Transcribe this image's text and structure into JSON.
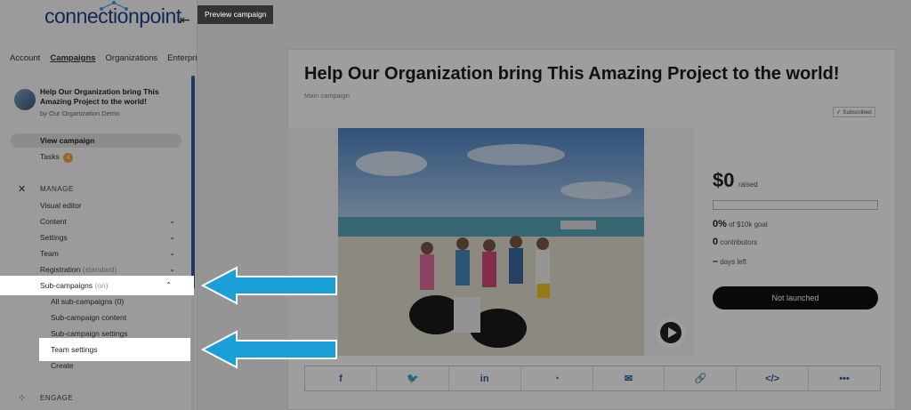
{
  "app": {
    "logo_text": "connectionpoint",
    "tooltip": "Preview campaign"
  },
  "sidebar": {
    "tabs": [
      "Account",
      "Campaigns",
      "Organizations",
      "Enterprise"
    ],
    "campaign": {
      "title": "Help Our Organization bring This Amazing Project to the world!",
      "by": "by Our Organization Demo"
    },
    "view_campaign": "View campaign",
    "tasks_label": "Tasks",
    "tasks_count": "4",
    "manage_heading": "MANAGE",
    "items": [
      {
        "label": "Visual editor",
        "chevron": ""
      },
      {
        "label": "Content",
        "chevron": "⌄"
      },
      {
        "label": "Settings",
        "chevron": "⌄"
      },
      {
        "label": "Team",
        "chevron": "⌄"
      },
      {
        "label": "Registration",
        "suffix": "(standard)",
        "chevron": "⌄"
      }
    ],
    "subcampaigns": {
      "label": "Sub-campaigns",
      "suffix": "(on)",
      "chevron": "⌃"
    },
    "sub_items": [
      "All sub-campaigns (0)",
      "Sub-campaign content",
      "Sub-campaign settings"
    ],
    "team_settings": "Team settings",
    "create": "Create",
    "engage_heading": "ENGAGE"
  },
  "campaign": {
    "title": "Help Our Organization bring This Amazing Project to the world!",
    "subtitle": "Main campaign",
    "subscribed": "Subscribed",
    "raised_amount": "$0",
    "raised_label": "raised",
    "progress_fraction": 0.0,
    "goal_pct": "0%",
    "goal_label": "of $10k goal",
    "contributors_count": "0",
    "contributors_label": "contributors",
    "days_value": "–",
    "days_label": "days left",
    "status_button": "Not launched"
  },
  "share": [
    "facebook-icon",
    "twitter-icon",
    "linkedin-icon",
    "messenger-icon",
    "email-icon",
    "link-icon",
    "embed-icon",
    "more-icon"
  ],
  "colors": {
    "accent": "#2d5ea0",
    "arrow": "#1a9fd8",
    "badge": "#f2a53b"
  }
}
